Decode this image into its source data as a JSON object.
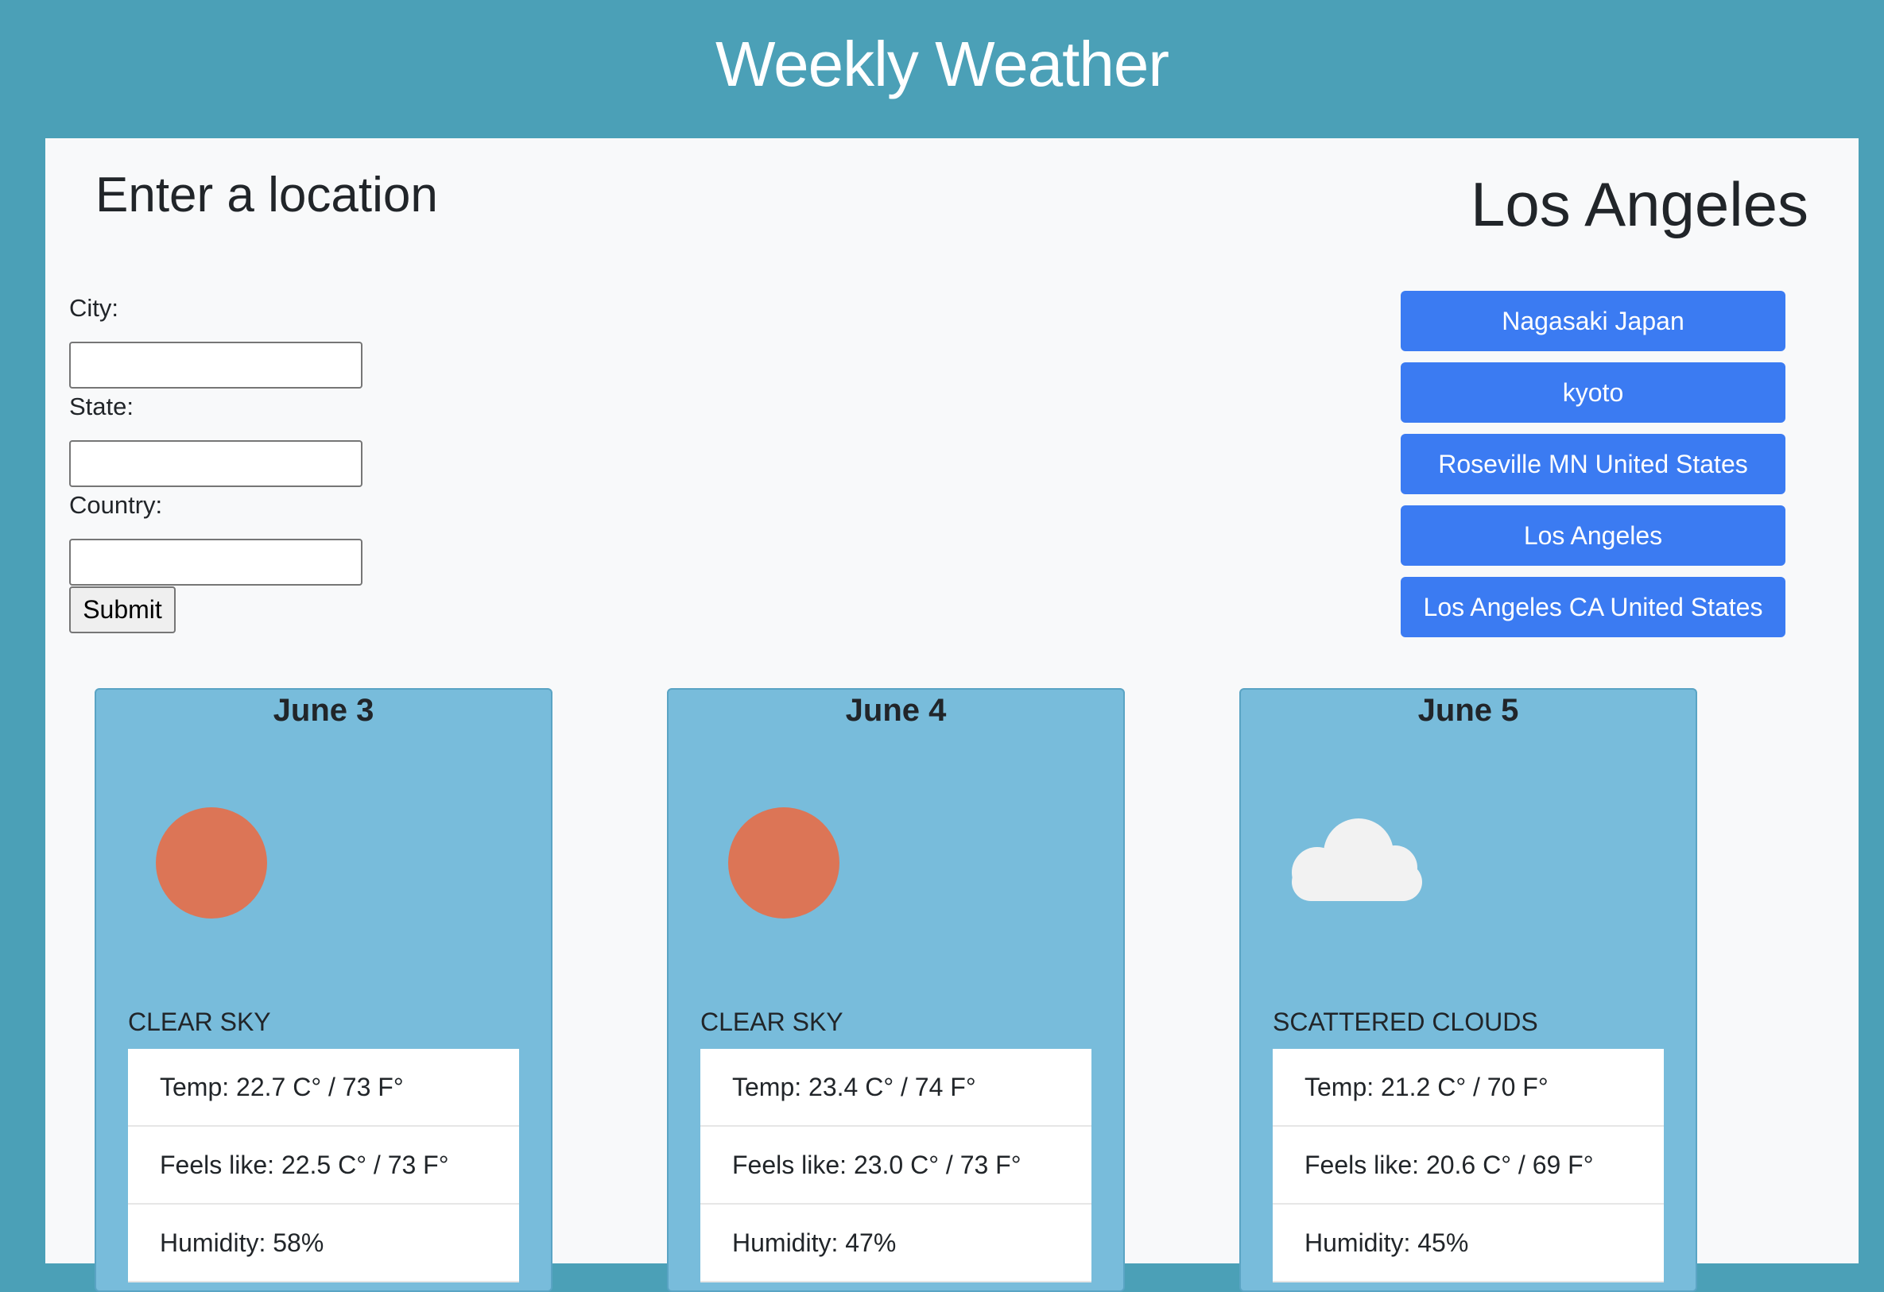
{
  "header": {
    "title": "Weekly Weather"
  },
  "form": {
    "heading": "Enter a location",
    "city_label": "City:",
    "state_label": "State:",
    "country_label": "Country:",
    "city_value": "",
    "state_value": "",
    "country_value": "",
    "submit_label": "Submit"
  },
  "location": {
    "name": "Los Angeles"
  },
  "history": [
    {
      "label": "Nagasaki Japan"
    },
    {
      "label": "kyoto"
    },
    {
      "label": "Roseville MN United States"
    },
    {
      "label": "Los Angeles"
    },
    {
      "label": "Los Angeles CA United States"
    }
  ],
  "forecast": [
    {
      "date": "June 3",
      "icon": "sun-icon",
      "condition": "clear sky",
      "temp": "Temp: 22.7 C° / 73 F°",
      "feels_like": "Feels like: 22.5 C° / 73 F°",
      "humidity": "Humidity: 58%"
    },
    {
      "date": "June 4",
      "icon": "sun-icon",
      "condition": "clear sky",
      "temp": "Temp: 23.4 C° / 74 F°",
      "feels_like": "Feels like: 23.0 C° / 73 F°",
      "humidity": "Humidity: 47%"
    },
    {
      "date": "June 5",
      "icon": "cloud-icon",
      "condition": "scattered clouds",
      "temp": "Temp: 21.2 C° / 70 F°",
      "feels_like": "Feels like: 20.6 C° / 69 F°",
      "humidity": "Humidity: 45%"
    }
  ],
  "colors": {
    "page_background": "#4ba0b7",
    "panel_background": "#f8f9fa",
    "history_button": "#3b7bf2",
    "card_background": "#78bcdb",
    "sun": "#dc7556",
    "cloud": "#f2f2f2"
  }
}
